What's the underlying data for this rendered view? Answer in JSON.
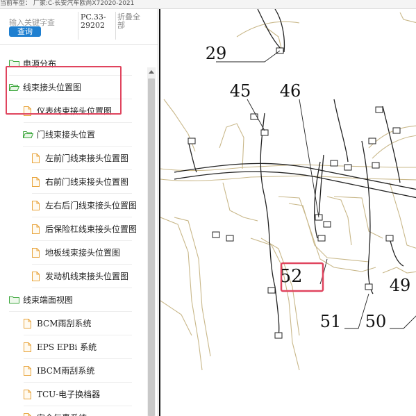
{
  "topbar": {
    "text": "当前车型： 厂家:C-长安汽车欧尚X72020-2021"
  },
  "search": {
    "placeholder": "输入关键字查",
    "query_label": "查询",
    "pc_code": "PC.33-29202",
    "collapse_all_label": "折叠全部"
  },
  "tree": {
    "items": [
      {
        "label": "电源分布",
        "type": "folder",
        "level": 0
      },
      {
        "label": "线束接头位置图",
        "type": "folder",
        "level": 0,
        "open": true
      },
      {
        "label": "仪表线束接头位置图",
        "type": "file",
        "level": 1
      },
      {
        "label": "门线束接头位置",
        "type": "folder",
        "level": 1,
        "open": true
      },
      {
        "label": "左前门线束接头位置图",
        "type": "file",
        "level": 2
      },
      {
        "label": "右前门线束接头位置图",
        "type": "file",
        "level": 2
      },
      {
        "label": "左右后门线束接头位置图",
        "type": "file",
        "level": 2
      },
      {
        "label": "后保险杠线束接头位置图",
        "type": "file",
        "level": 2
      },
      {
        "label": "地板线束接头位置图",
        "type": "file",
        "level": 2
      },
      {
        "label": "发动机线束接头位置图",
        "type": "file",
        "level": 2
      },
      {
        "label": "线束端面视图",
        "type": "folder",
        "level": 0
      },
      {
        "label": "BCM雨刮系统",
        "type": "file",
        "level": 1
      },
      {
        "label": "EPS EPBi 系统",
        "type": "file",
        "level": 1
      },
      {
        "label": "IBCM雨刮系统",
        "type": "file",
        "level": 1
      },
      {
        "label": "TCU-电子换档器",
        "type": "file",
        "level": 1
      },
      {
        "label": "安全气囊系统",
        "type": "file",
        "level": 1
      }
    ]
  },
  "diagram": {
    "callouts": [
      "29",
      "45",
      "46",
      "52",
      "51",
      "50",
      "49"
    ],
    "line_color": "#c9b88a",
    "highlight_color": "#e0445e"
  },
  "colors": {
    "accent": "#1e7fd0",
    "highlight": "#e0445e",
    "folder": "#3aa63a",
    "file": "#e8a33a"
  }
}
